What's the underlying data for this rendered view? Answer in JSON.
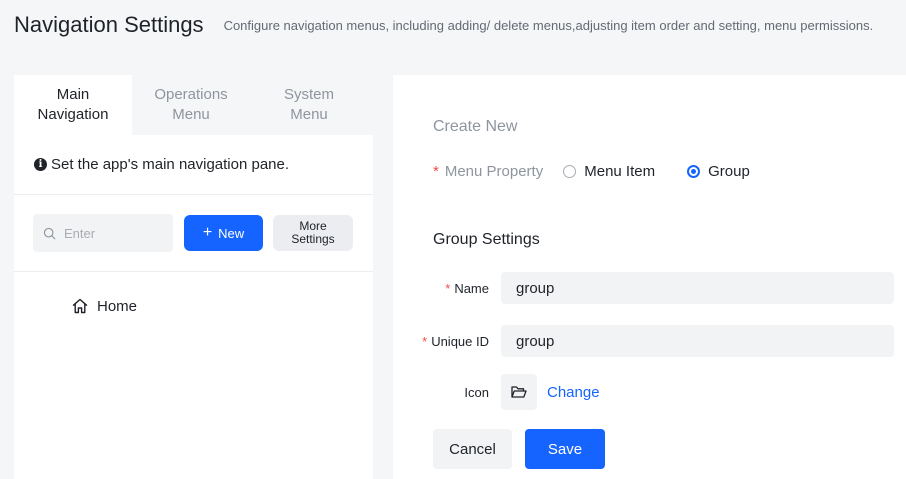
{
  "page": {
    "title": "Navigation Settings",
    "subtitle": "Configure navigation menus, including adding/ delete menus,adjusting item order and setting, menu permissions."
  },
  "tabs": [
    {
      "label": "Main Navigation",
      "active": true
    },
    {
      "label": "Operations Menu",
      "active": false
    },
    {
      "label": "System Menu",
      "active": false
    }
  ],
  "hint": {
    "text": "Set the app's main navigation pane.",
    "icon": "info-icon"
  },
  "toolbar": {
    "search_placeholder": "Enter",
    "new_label": "New",
    "more_label": "More Settings"
  },
  "tree": {
    "items": [
      {
        "label": "Home",
        "icon": "home-icon"
      }
    ]
  },
  "form": {
    "create_title": "Create New",
    "menu_property_label": "Menu Property",
    "required_mark": "*",
    "options": [
      {
        "label": "Menu Item",
        "checked": false
      },
      {
        "label": "Group",
        "checked": true
      }
    ],
    "group_title": "Group Settings",
    "name_label": "Name",
    "name_value": "group",
    "uid_label": "Unique ID",
    "uid_value": "group",
    "icon_label": "Icon",
    "icon_name": "folder-open-icon",
    "change_label": "Change",
    "cancel_label": "Cancel",
    "save_label": "Save"
  },
  "colors": {
    "accent": "#1664ff",
    "required": "#f54a45",
    "muted": "#8f959e",
    "background": "#f5f6f8"
  }
}
